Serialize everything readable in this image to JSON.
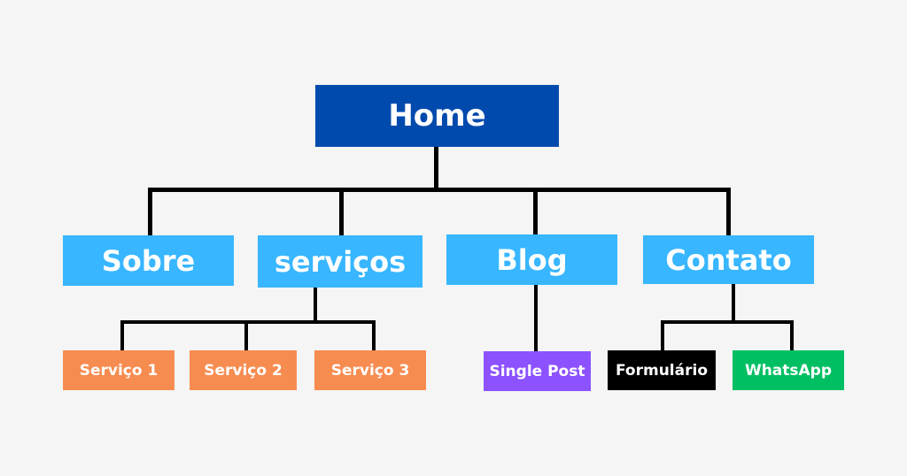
{
  "diagram": {
    "type": "sitemap-tree",
    "root": {
      "label": "Home",
      "color": "#004aad"
    },
    "level1": [
      {
        "label": "Sobre",
        "color": "#38b6ff"
      },
      {
        "label": "serviços",
        "color": "#38b6ff"
      },
      {
        "label": "Blog",
        "color": "#38b6ff"
      },
      {
        "label": "Contato",
        "color": "#38b6ff"
      }
    ],
    "level2": [
      {
        "label": "Serviço 1",
        "parent": "serviços",
        "color": "#f78c50"
      },
      {
        "label": "Serviço 2",
        "parent": "serviços",
        "color": "#f78c50"
      },
      {
        "label": "Serviço 3",
        "parent": "serviços",
        "color": "#f78c50"
      },
      {
        "label": "Single Post",
        "parent": "Blog",
        "color": "#8c52ff"
      },
      {
        "label": "Formulário",
        "parent": "Contato",
        "color": "#000000"
      },
      {
        "label": "WhatsApp",
        "parent": "Contato",
        "color": "#00bf63"
      }
    ],
    "connector_color": "#000000",
    "background": "#f4f5f4"
  }
}
